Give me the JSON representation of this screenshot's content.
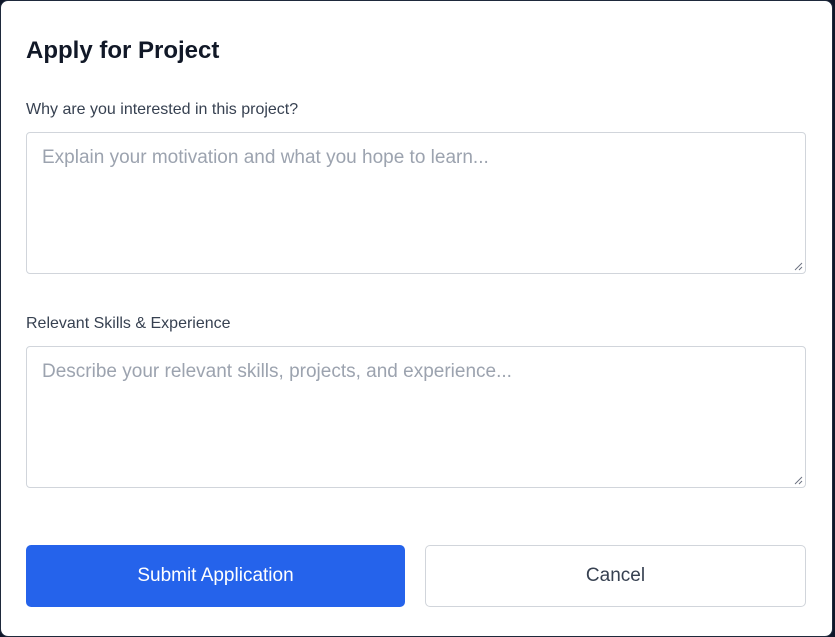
{
  "modal": {
    "title": "Apply for Project",
    "fields": [
      {
        "label": "Why are you interested in this project?",
        "value": "",
        "placeholder": "Explain your motivation and what you hope to learn..."
      },
      {
        "label": "Relevant Skills & Experience",
        "value": "",
        "placeholder": "Describe your relevant skills, projects, and experience..."
      }
    ],
    "buttons": {
      "submit_label": "Submit Application",
      "cancel_label": "Cancel"
    }
  },
  "colors": {
    "primary": "#2563eb",
    "text": "#111827",
    "label": "#374151",
    "placeholder": "#9ca3af",
    "border": "#d1d5db"
  },
  "icons": [
    "resize-grip-icon"
  ]
}
